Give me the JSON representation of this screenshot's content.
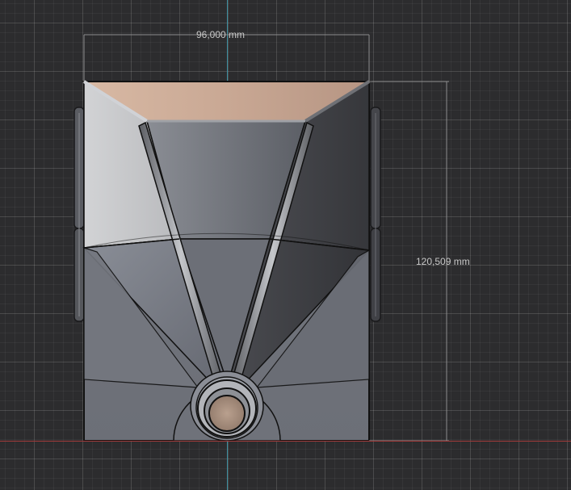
{
  "dimensions": {
    "width_label": "96,000 mm",
    "height_label": "120,509 mm"
  },
  "colors": {
    "background": "#2c2c2e",
    "y_axis": "#3c8fa0",
    "x_axis": "#a23a3a",
    "dimension_line": "#9a9a9a",
    "dimension_text": "#c8c8c8",
    "top_face": "#c9a894",
    "light_face": "#c9cacc",
    "mid_face": "#7f828a",
    "dark_face": "#3c3d41",
    "body_face": "#6b6e76"
  }
}
